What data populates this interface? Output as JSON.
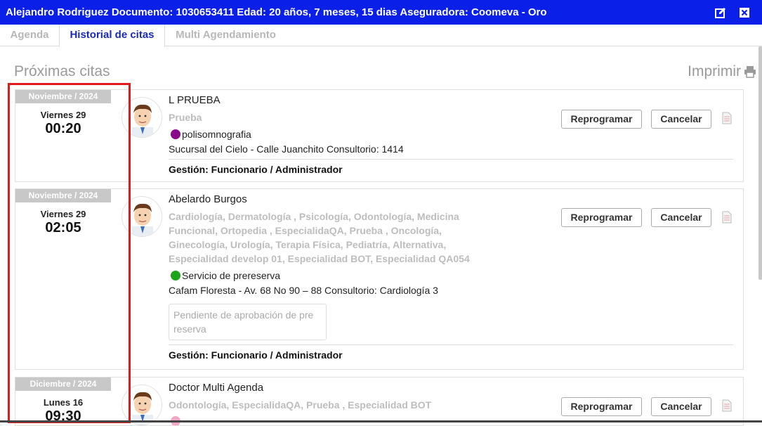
{
  "header": {
    "title": "Alejandro Rodriguez  Documento: 1030653411  Edad: 20 años, 7 meses, 15 dias  Aseguradora: Coomeva  - Oro",
    "edit_icon": "edit-icon",
    "close_icon": "close-icon",
    "bg_color": "#0a1fe8"
  },
  "tabs": [
    {
      "label": "Agenda",
      "active": false
    },
    {
      "label": "Historial de citas",
      "active": true
    },
    {
      "label": "Multi Agendamiento",
      "active": false
    }
  ],
  "section": {
    "title": "Próximas citas",
    "print_label": "Imprimir",
    "print_icon": "printer-icon"
  },
  "buttons": {
    "reschedule": "Reprogramar",
    "cancel": "Cancelar"
  },
  "appointments": [
    {
      "month": "Noviembre / 2024",
      "day": "Viernes 29",
      "time": "00:20",
      "doctor": "L PRUEBA",
      "specialties": "Prueba",
      "service": "polisomnografia",
      "service_color": "#8b0a8b",
      "address": "Sucursal del Cielo - Calle Juanchito Consultorio: 1414",
      "gestion": "Gestión: Funcionario / Administrador"
    },
    {
      "month": "Noviembre / 2024",
      "day": "Viernes 29",
      "time": "02:05",
      "doctor": "Abelardo Burgos",
      "specialties": "Cardiología, Dermatología , Psicología, Odontología, Medicina Funcional, Ortopedia , EspecialidaQA, Prueba , Oncología, Ginecología, Urología, Terapia Física, Pediatría, Alternativa, Especialidad develop 01, Especialidad BOT, Especialidad QA054",
      "service": "Servicio de prereserva",
      "service_color": "#1aa51a",
      "address": "Cafam Floresta - Av. 68 No 90 – 88 Consultorio: Cardiología 3",
      "pending": "Pendiente de aprobación de pre reserva",
      "gestion": "Gestión: Funcionario / Administrador"
    },
    {
      "month": "Diciembre / 2024",
      "day": "Lunes 16",
      "time": "09:30",
      "doctor": "Doctor Multi Agenda",
      "specialties": "Odontología, EspecialidaQA, Prueba , Especialidad BOT",
      "service_color": "#f2a7c7"
    }
  ]
}
